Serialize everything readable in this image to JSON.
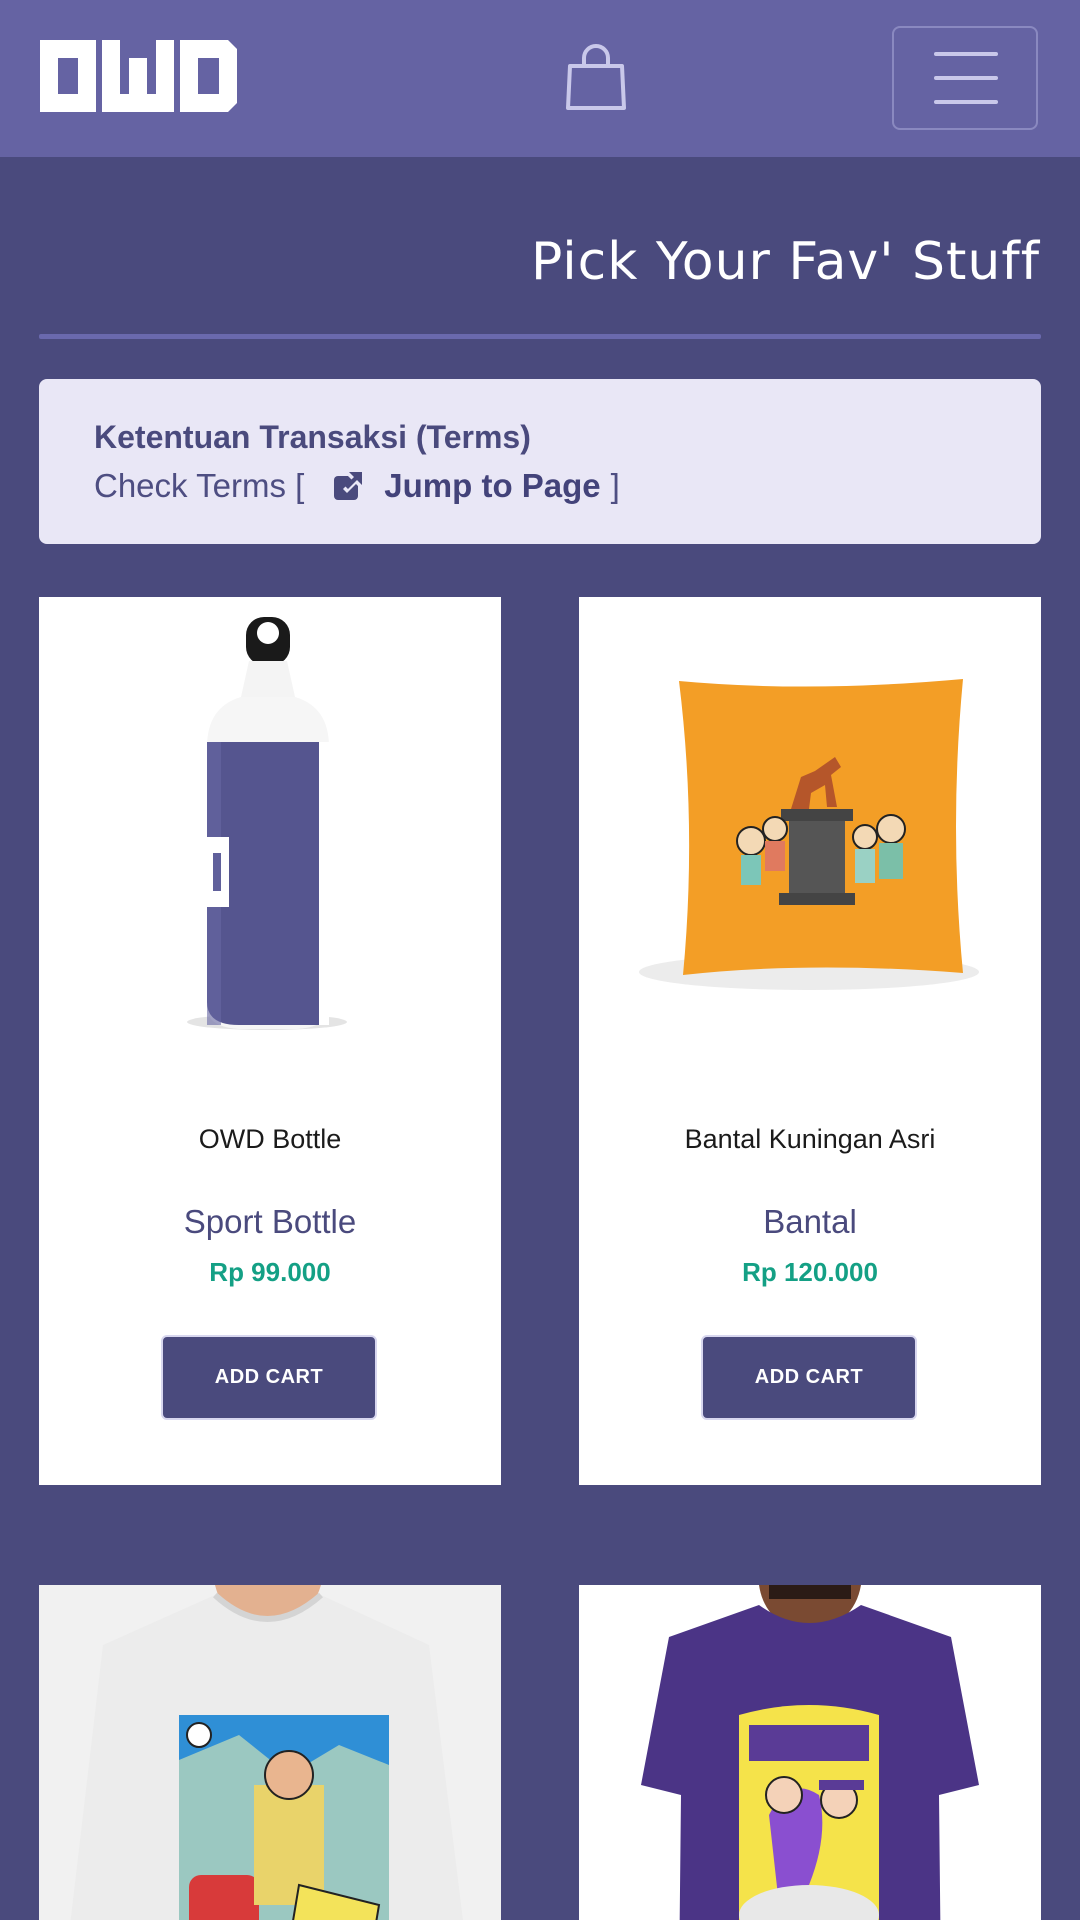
{
  "header": {
    "logo_text": "OWD",
    "bag_icon": "shopping-bag-icon",
    "menu_icon": "hamburger-menu-icon"
  },
  "page": {
    "title": "Pick Your Fav' Stuff"
  },
  "terms": {
    "title": "Ketentuan Transaksi (Terms)",
    "check_prefix": "Check Terms [",
    "link_icon": "external-link-icon",
    "link_label": "Jump to Page",
    "check_suffix": "]"
  },
  "products": [
    {
      "name": "OWD Bottle",
      "type": "Sport Bottle",
      "price": "Rp 99.000",
      "button": "ADD CART",
      "image": "bottle"
    },
    {
      "name": "Bantal Kuningan Asri",
      "type": "Bantal",
      "price": "Rp 120.000",
      "button": "ADD CART",
      "image": "pillow"
    },
    {
      "name": "",
      "type": "",
      "price": "",
      "button": "",
      "image": "longsleeve-shirt"
    },
    {
      "name": "",
      "type": "",
      "price": "",
      "button": "",
      "image": "purple-tshirt"
    }
  ],
  "colors": {
    "header_bg": "#6563a3",
    "page_bg": "#4a4a7d",
    "price": "#14a085",
    "terms_bg": "#e9e7f6"
  }
}
